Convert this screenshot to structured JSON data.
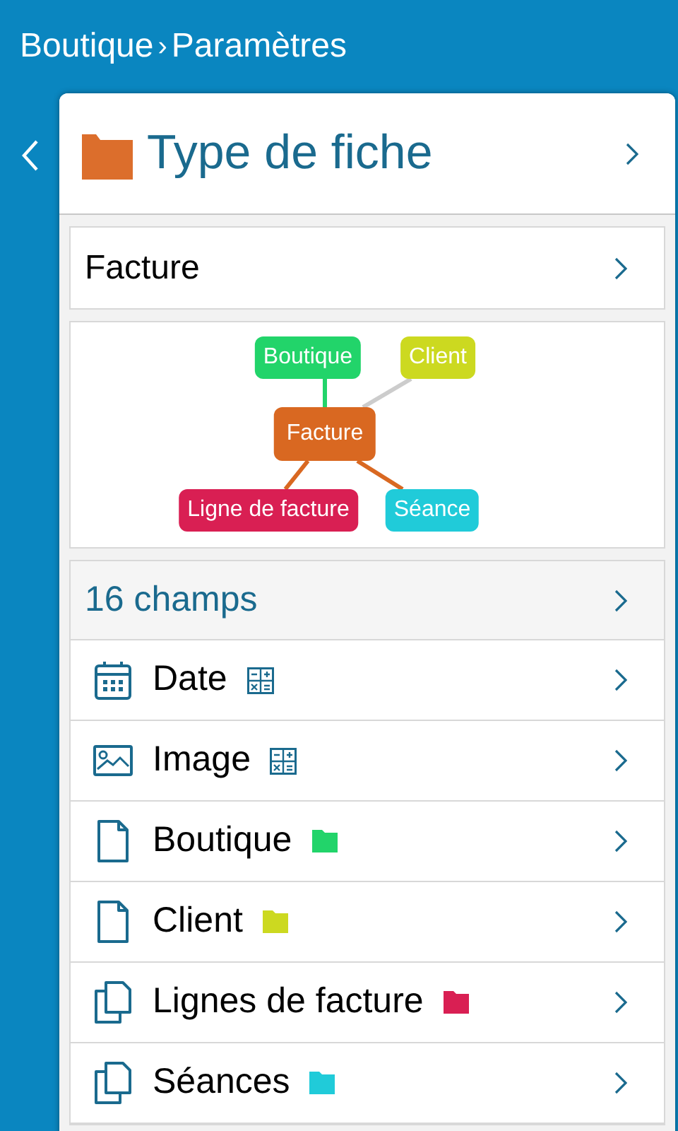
{
  "breadcrumb": {
    "items": [
      "Boutique",
      "Paramètres"
    ],
    "separator": "›"
  },
  "header": {
    "title": "Type de fiche"
  },
  "record_type": {
    "label": "Facture"
  },
  "diagram": {
    "nodes": [
      {
        "label": "Boutique",
        "color": "#22d46a"
      },
      {
        "label": "Client",
        "color": "#ccd920"
      },
      {
        "label": "Facture",
        "color": "#d96821"
      },
      {
        "label": "Ligne de facture",
        "color": "#d91f53"
      },
      {
        "label": "Séance",
        "color": "#20cbd9"
      }
    ],
    "edges": [
      {
        "color": "#22d46a"
      },
      {
        "color": "#cccccc"
      },
      {
        "color": "#d96821"
      },
      {
        "color": "#d96821"
      }
    ]
  },
  "fields": {
    "count_label": "16 champs",
    "items": [
      {
        "label": "Date",
        "kind": "date",
        "grid_badge": true
      },
      {
        "label": "Image",
        "kind": "image",
        "grid_badge": true
      },
      {
        "label": "Boutique",
        "kind": "link",
        "grid_badge": false,
        "color": "#22d46a"
      },
      {
        "label": "Client",
        "kind": "link",
        "grid_badge": false,
        "color": "#ccd920"
      },
      {
        "label": "Lignes de facture",
        "kind": "multi-link",
        "grid_badge": false,
        "color": "#d91f53"
      },
      {
        "label": "Séances",
        "kind": "multi-link",
        "grid_badge": false,
        "color": "#20cbd9"
      }
    ]
  }
}
